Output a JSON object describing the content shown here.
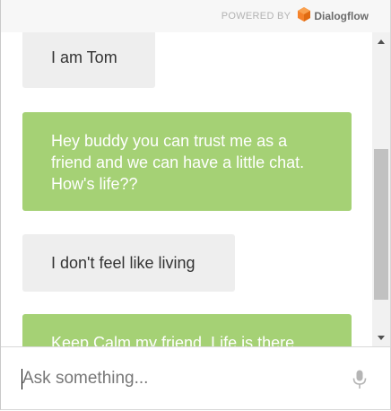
{
  "header": {
    "powered_by": "POWERED BY",
    "brand": "Dialogflow",
    "brand_icon": "dialogflow-logo-icon",
    "brand_color": "#f5822a"
  },
  "messages": [
    {
      "from": "user",
      "text": "I am Tom"
    },
    {
      "from": "bot",
      "text": "Hey buddy you can trust me as a friend and we can have a little chat. How's life??"
    },
    {
      "from": "user",
      "text": "I don't feel like living"
    },
    {
      "from": "bot",
      "text": "Keep Calm my friend. Life is there"
    }
  ],
  "input": {
    "placeholder": "Ask something...",
    "value": "",
    "mic_icon": "microphone-icon"
  },
  "colors": {
    "bot_bubble": "#a5d175",
    "user_bubble": "#eeeeee",
    "header_bg": "#f7f7f7"
  }
}
